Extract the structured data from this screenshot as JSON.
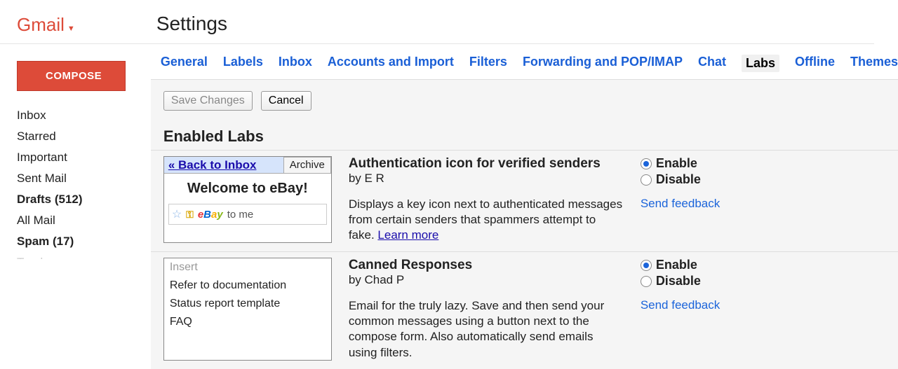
{
  "brand": "Gmail",
  "compose": "COMPOSE",
  "nav": [
    {
      "label": "Inbox",
      "bold": false
    },
    {
      "label": "Starred",
      "bold": false
    },
    {
      "label": "Important",
      "bold": false
    },
    {
      "label": "Sent Mail",
      "bold": false
    },
    {
      "label": "Drafts (512)",
      "bold": true
    },
    {
      "label": "All Mail",
      "bold": false
    },
    {
      "label": "Spam (17)",
      "bold": true
    },
    {
      "label": "Trash",
      "bold": false
    }
  ],
  "page_title": "Settings",
  "tabs": [
    "General",
    "Labels",
    "Inbox",
    "Accounts and Import",
    "Filters",
    "Forwarding and POP/IMAP",
    "Chat",
    "Labs",
    "Offline",
    "Themes"
  ],
  "active_tab": "Labs",
  "buttons": {
    "save": "Save Changes",
    "cancel": "Cancel"
  },
  "section": "Enabled Labs",
  "labs": [
    {
      "title": "Authentication icon for verified senders",
      "by": "by E R",
      "desc": "Displays a key icon next to authenticated messages from certain senders that spammers attempt to fake.",
      "learn_more": "Learn more",
      "enable": "Enable",
      "disable": "Disable",
      "feedback": "Send feedback",
      "thumb": {
        "back": "« Back to Inbox",
        "archive": "Archive",
        "welcome": "Welcome to eBay!",
        "sender": "eBay",
        "tome": "to me"
      }
    },
    {
      "title": "Canned Responses",
      "by": "by Chad P",
      "desc": "Email for the truly lazy. Save and then send your common messages using a button next to the compose form. Also automatically send emails using filters.",
      "enable": "Enable",
      "disable": "Disable",
      "feedback": "Send feedback",
      "thumb": {
        "items": [
          "Insert",
          "Refer to documentation",
          "Status report template",
          "FAQ"
        ]
      }
    }
  ]
}
